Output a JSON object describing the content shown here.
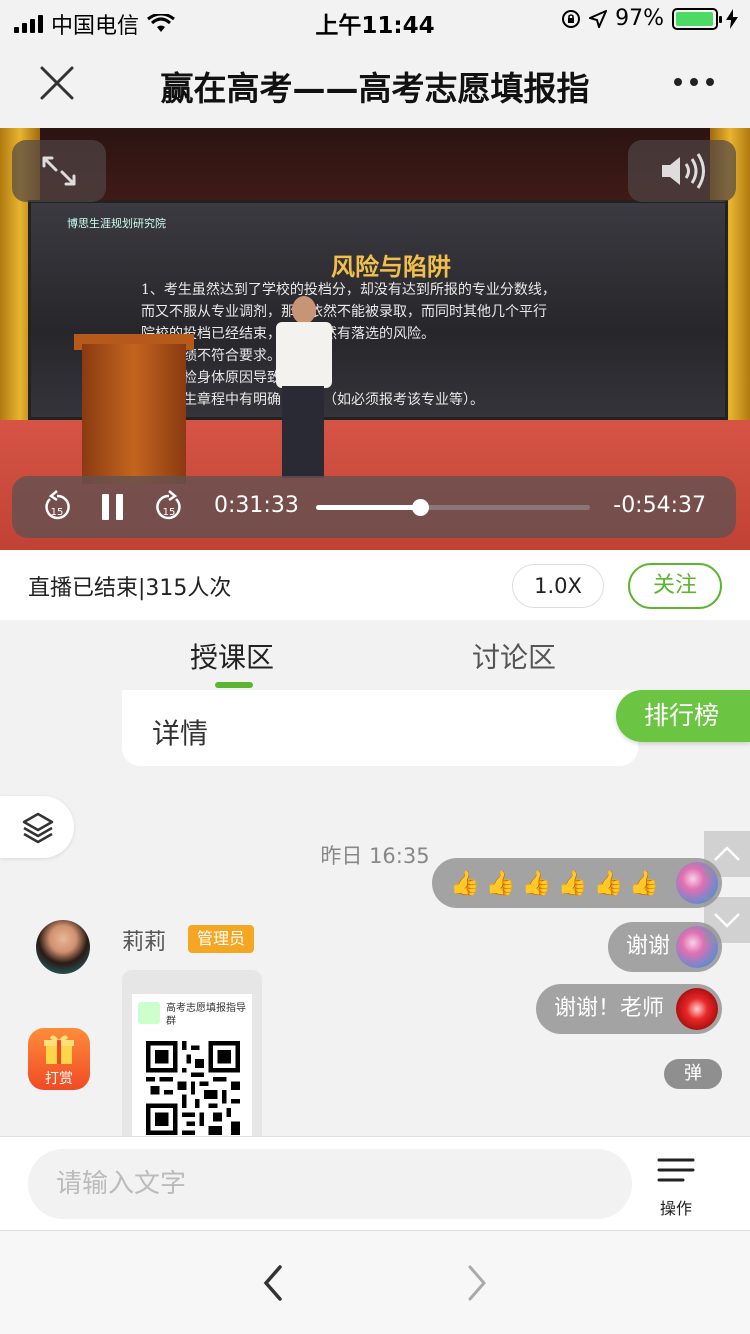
{
  "status_bar": {
    "carrier": "中国电信",
    "time": "上午11:44",
    "battery_percent": "97%",
    "battery_level": 0.97
  },
  "nav": {
    "title": "赢在高考——高考志愿填报指"
  },
  "video": {
    "current_time": "0:31:33",
    "remaining_time": "-0:54:37",
    "progress": 0.38,
    "rewind_label": "15",
    "forward_label": "15",
    "slide_title": "风险与陷阱",
    "slide_logo": "博思生涯规划研究院",
    "slide_lines": [
      "1、考生虽然达到了学校的投档分，却没有达到所报的专业分数线，",
      "而又不服从专业调剂，那么依然不能被录取，而同时其他几个平行",
      "院校的投档已经结束，考生依然有落选的风险。",
      "单科成绩不符合要求。",
      "考生体检身体原因导致的退档。",
      "院校招生章程中有明确的规定（如必须报考该专业等）。"
    ]
  },
  "info": {
    "live_status": "直播已结束|315人次",
    "speed": "1.0X",
    "follow": "关注"
  },
  "tabs": {
    "teach": "授课区",
    "discuss": "讨论区"
  },
  "content": {
    "detail": "详情",
    "ranking": "排行榜",
    "timestamp": "昨日 16:35",
    "user_name": "莉莉",
    "admin_badge": "管理员",
    "gift_label": "打赏",
    "qr_title": "高考志愿填报指导群"
  },
  "danmu": [
    {
      "text": "👍👍👍👍👍👍",
      "avatar": "flower-avatar"
    },
    {
      "text": "谢谢",
      "avatar": "flower-avatar"
    },
    {
      "text": "谢谢！老师",
      "avatar": "red-flower-avatar"
    }
  ],
  "danmu_toggle": "弹",
  "input": {
    "placeholder": "请输入文字",
    "ops_label": "操作"
  }
}
